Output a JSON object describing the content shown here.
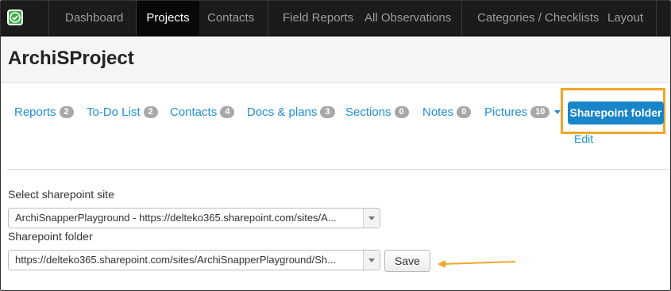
{
  "nav": {
    "items": [
      {
        "label": "Dashboard"
      },
      {
        "label": "Projects"
      },
      {
        "label": "Contacts"
      },
      {
        "label": "Field Reports"
      },
      {
        "label": "All Observations"
      },
      {
        "label": "Categories / Checklists"
      },
      {
        "label": "Layout"
      }
    ],
    "active": "Projects",
    "logo_icon": "check-circle-icon"
  },
  "project": {
    "title": "ArchiSProject"
  },
  "tabs": [
    {
      "label": "Reports",
      "count": "2"
    },
    {
      "label": "To-Do List",
      "count": "2"
    },
    {
      "label": "Contacts",
      "count": "4"
    },
    {
      "label": "Docs & plans",
      "count": "3"
    },
    {
      "label": "Sections",
      "count": "0"
    },
    {
      "label": "Notes",
      "count": "0"
    },
    {
      "label": "Pictures",
      "count": "10"
    }
  ],
  "sharepoint_button": {
    "label": "Sharepoint folder"
  },
  "edit_link": {
    "label": "Edit"
  },
  "form": {
    "site_label": "Select sharepoint site",
    "site_value": "ArchiSnapperPlayground - https://delteko365.sharepoint.com/sites/A...",
    "folder_label": "Sharepoint folder",
    "folder_value": "https://delteko365.sharepoint.com/sites/ArchiSnapperPlayground/Sh...",
    "save_label": "Save"
  },
  "colors": {
    "navbar": "#1b1b1b",
    "link": "#1f8fd8",
    "primary_button": "#1985c9",
    "highlight": "#f0a626",
    "badge": "#a8a8a8"
  }
}
